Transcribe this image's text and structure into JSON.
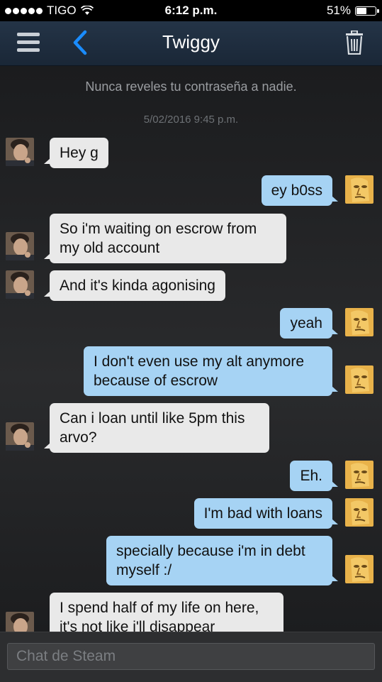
{
  "status_bar": {
    "carrier": "TIGO",
    "time": "6:12 p.m.",
    "battery": "51%",
    "battery_level": 0.51
  },
  "nav": {
    "title": "Twiggy",
    "icons": [
      "menu-icon",
      "back-icon",
      "trash-icon"
    ]
  },
  "chat": {
    "notice": "Nunca reveles tu contraseña a nadie.",
    "date": "5/02/2016 9:45 p.m.",
    "messages": [
      {
        "from": "them",
        "text": "Hey g"
      },
      {
        "from": "me",
        "text": "ey b0ss"
      },
      {
        "from": "them",
        "text": "So i'm waiting on escrow from my old account"
      },
      {
        "from": "them",
        "text": "And it's kinda agonising"
      },
      {
        "from": "me",
        "text": "yeah"
      },
      {
        "from": "me",
        "text": "I don't even use my alt anymore because of escrow"
      },
      {
        "from": "them",
        "text": "Can i loan until like 5pm this arvo?"
      },
      {
        "from": "me",
        "text": "Eh."
      },
      {
        "from": "me",
        "text": "I'm bad with loans"
      },
      {
        "from": "me",
        "text": "specially because i'm in debt myself :/"
      },
      {
        "from": "them",
        "text": "I spend half of my life on here, it's not like i'll disappear"
      }
    ]
  },
  "input": {
    "placeholder": "Chat de Steam"
  },
  "colors": {
    "incoming_bubble": "#e9e9e9",
    "outgoing_bubble": "#a6d3f4",
    "navbar": "#1f2d3d",
    "accent": "#1a8cff"
  }
}
